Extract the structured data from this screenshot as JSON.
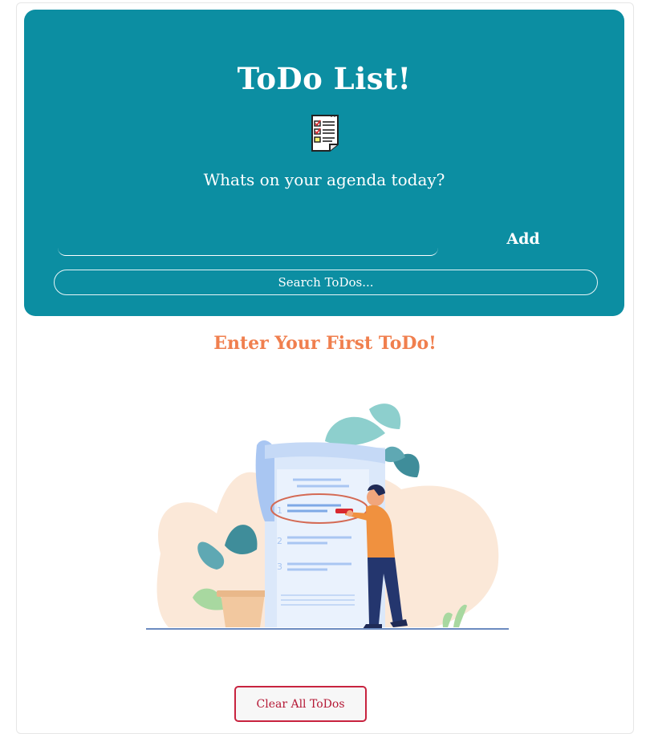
{
  "header": {
    "title": "ToDo List!",
    "subtitle": "Whats on your agenda today?",
    "icon": "notepad-checklist-icon"
  },
  "form": {
    "todo_value": "",
    "add_label": "Add",
    "search_placeholder": "Search ToDos..."
  },
  "empty_state": {
    "message": "Enter Your First ToDo!",
    "illustration": "person-checking-todo-list-illustration"
  },
  "footer": {
    "clear_label": "Clear All ToDos"
  },
  "colors": {
    "hero_bg": "#0c8ea2",
    "accent_orange": "#f07f4e",
    "clear_border": "#c8233f"
  }
}
